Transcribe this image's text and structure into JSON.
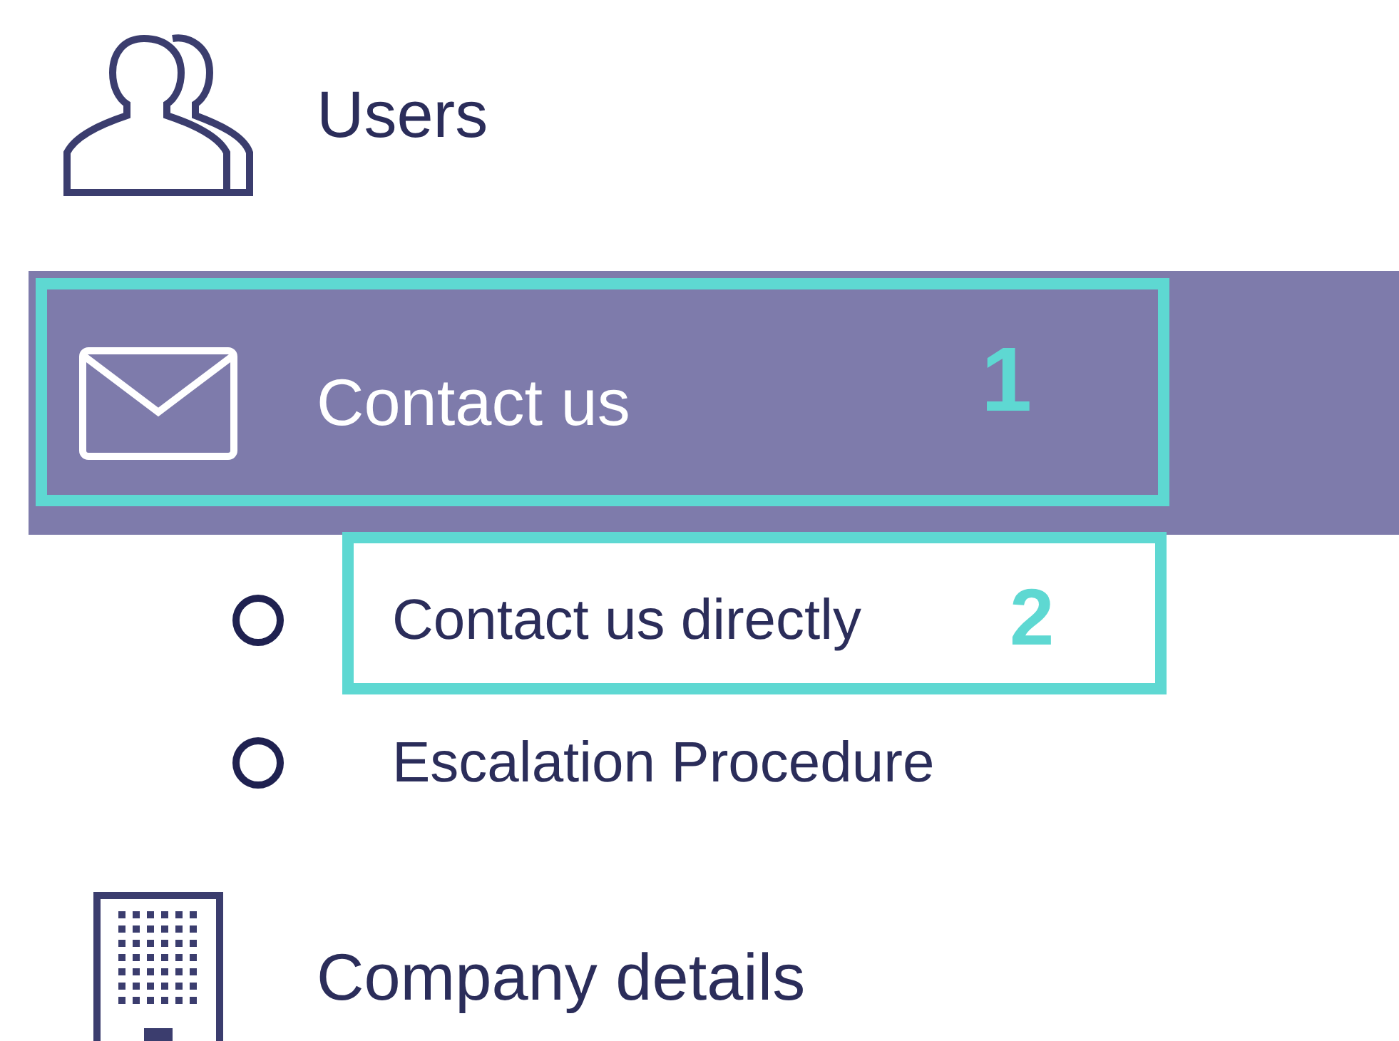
{
  "menu": [
    {
      "label": "Users",
      "selected": false
    },
    {
      "label": "Contact us",
      "selected": true,
      "expanded": true,
      "callout": "1",
      "children": [
        {
          "label": "Contact us directly",
          "callout": "2"
        },
        {
          "label": "Escalation Procedure"
        }
      ]
    },
    {
      "label": "Company details",
      "selected": false
    }
  ]
}
